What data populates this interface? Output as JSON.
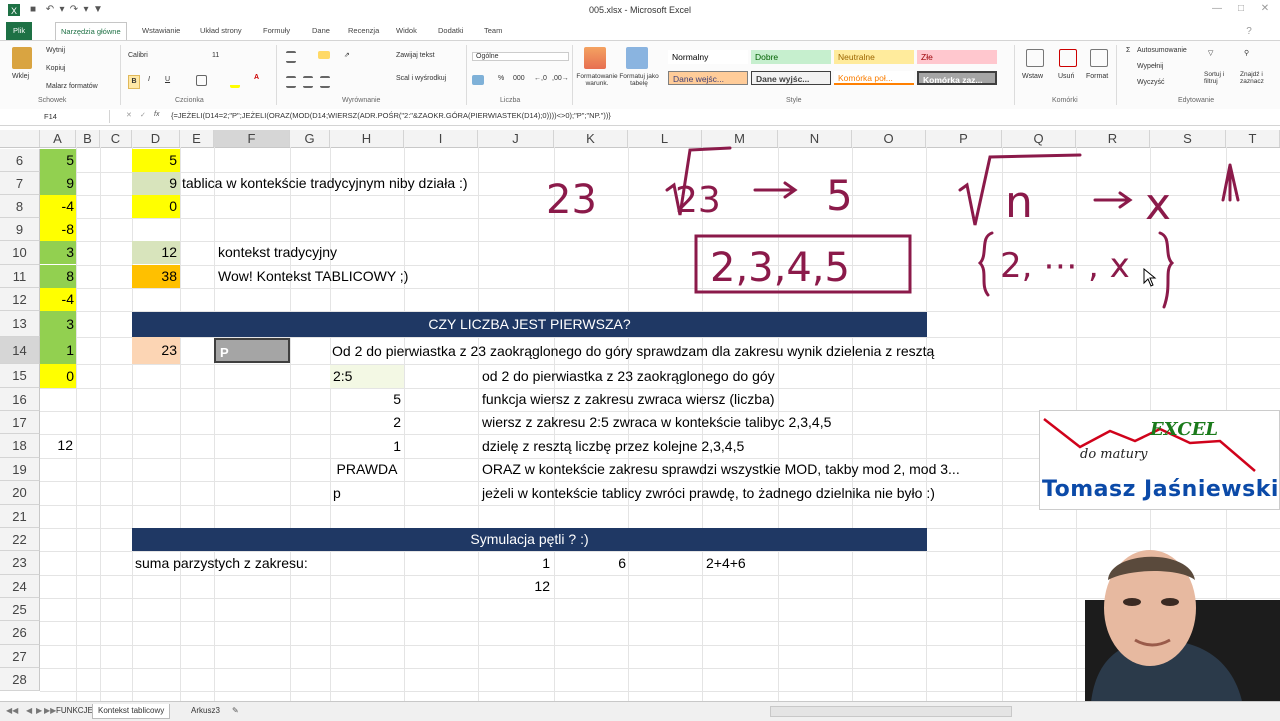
{
  "window": {
    "title": "005.xlsx - Microsoft Excel"
  },
  "ribbon_tabs": [
    "Plik",
    "Narzędzia główne",
    "Wstawianie",
    "Układ strony",
    "Formuły",
    "Dane",
    "Recenzja",
    "Widok",
    "Dodatki",
    "Team"
  ],
  "ribbon": {
    "clipboard": {
      "paste": "Wklej",
      "cut": "Wytnij",
      "copy": "Kopiuj",
      "painter": "Malarz formatów",
      "group": "Schowek"
    },
    "font": {
      "name": "Calibri",
      "size": "11",
      "bold": "B",
      "italic": "I",
      "underline": "U",
      "group": "Czcionka"
    },
    "alignment": {
      "wrap": "Zawijaj tekst",
      "merge": "Scal i wyśrodkuj",
      "group": "Wyrównanie"
    },
    "number": {
      "format": "Ogólne",
      "percent": "%",
      "comma": "000",
      "group": "Liczba"
    },
    "styles": {
      "cond_format": "Formatowanie warunk.",
      "as_table": "Formatuj jako tabelę",
      "normal": "Normalny",
      "good": "Dobre",
      "neutral": "Neutralne",
      "bad": "Złe",
      "input": "Dane wejśc...",
      "output": "Dane wyjśc...",
      "linked": "Komórka poł...",
      "check": "Komórka zaz...",
      "group": "Style"
    },
    "cells": {
      "insert": "Wstaw",
      "delete": "Usuń",
      "format": "Format",
      "group": "Komórki"
    },
    "editing": {
      "autosum": "Autosumowanie",
      "fill": "Wypełnij",
      "clear": "Wyczyść",
      "sort": "Sortuj i filtruj",
      "find": "Znajdź i zaznacz",
      "group": "Edytowanie"
    }
  },
  "formula_bar": {
    "cell_ref": "F14",
    "formula": "{=JEŻELI(D14=2;\"P\";JEŻELI(ORAZ(MOD(D14;WIERSZ(ADR.POŚR(\"2:\"&ZAOKR.GÓRA(PIERWIASTEK(D14);0))))<>0);\"P\";\"NP.\"))}"
  },
  "columns": [
    "A",
    "B",
    "C",
    "D",
    "E",
    "F",
    "G",
    "H",
    "I",
    "J",
    "K",
    "L",
    "M",
    "N",
    "O",
    "P",
    "Q",
    "R",
    "S",
    "T"
  ],
  "rows": [
    "6",
    "7",
    "8",
    "9",
    "10",
    "11",
    "12",
    "13",
    "14",
    "15",
    "16",
    "17",
    "18",
    "19",
    "20",
    "21",
    "22",
    "23",
    "24",
    "25",
    "26",
    "27",
    "28"
  ],
  "cells": {
    "A6": "5",
    "A7": "9",
    "A8": "-4",
    "A9": "-8",
    "A10": "3",
    "A11": "8",
    "A12": "-4",
    "A13": "3",
    "A14": "1",
    "A15": "0",
    "A18": "12",
    "D6": "5",
    "D7": "9",
    "D8": "0",
    "D10": "12",
    "D11": "38",
    "D14": "23",
    "E7": "tablica w kontekście tradycyjnym niby działa :)",
    "F10": "kontekst tradycyjny",
    "F11": "Wow! Kontekst TABLICOWY ;)",
    "F14": "P",
    "banner1": "CZY LICZBA JEST PIERWSZA?",
    "H14": "Od 2 do pierwiastka z 23 zaokrąglonego do góry sprawdzam dla zakresu wynik dzielenia z resztą",
    "H15": "2:5",
    "H16": "5",
    "H17": "2",
    "H18": "1",
    "H19": "PRAWDA",
    "H20": "p",
    "J15": "od 2 do pierwiastka z 23 zaokrąglonego do góy",
    "J16": "funkcja wiersz z zakresu zwraca wiersz (liczba)",
    "J17": "wiersz z zakresu 2:5 zwraca w kontekście talibyc 2,3,4,5",
    "J18": "dzielę z resztą liczbę przez kolejne 2,3,4,5",
    "J19": "ORAZ w kontekście zakresu sprawdzi wszystkie MOD, takby mod 2, mod 3...",
    "J20": "jeżeli w kontekście tablicy zwróci prawdę, to żadnego dzielnika nie było :)",
    "banner2": "Symulacja pętli ? :)",
    "D23": "suma parzystych z zakresu:",
    "J23": "1",
    "K23": "6",
    "M23": "2+4+6",
    "J24": "12"
  },
  "handwriting": {
    "n23": "23",
    "sqrt23": "√23 → 5",
    "box": "2,3,4,5",
    "general": "√n → x ↑",
    "set": "{2, ..., x}"
  },
  "logo": {
    "excel": "EXCEL",
    "sub": "do matury",
    "author": "Tomasz Jaśniewski"
  },
  "sheets": [
    "FUNKCJE",
    "Kontekst tablicowy",
    "Arkusz3"
  ],
  "colors": {
    "excel_green": "#1e7145",
    "banner": "#1f3864",
    "green": "#92d050",
    "yellow": "#ffff00",
    "light_green": "#d8e4bc",
    "orange": "#ffc000",
    "peach": "#fcd5b4",
    "ink": "#8b1a4a"
  }
}
